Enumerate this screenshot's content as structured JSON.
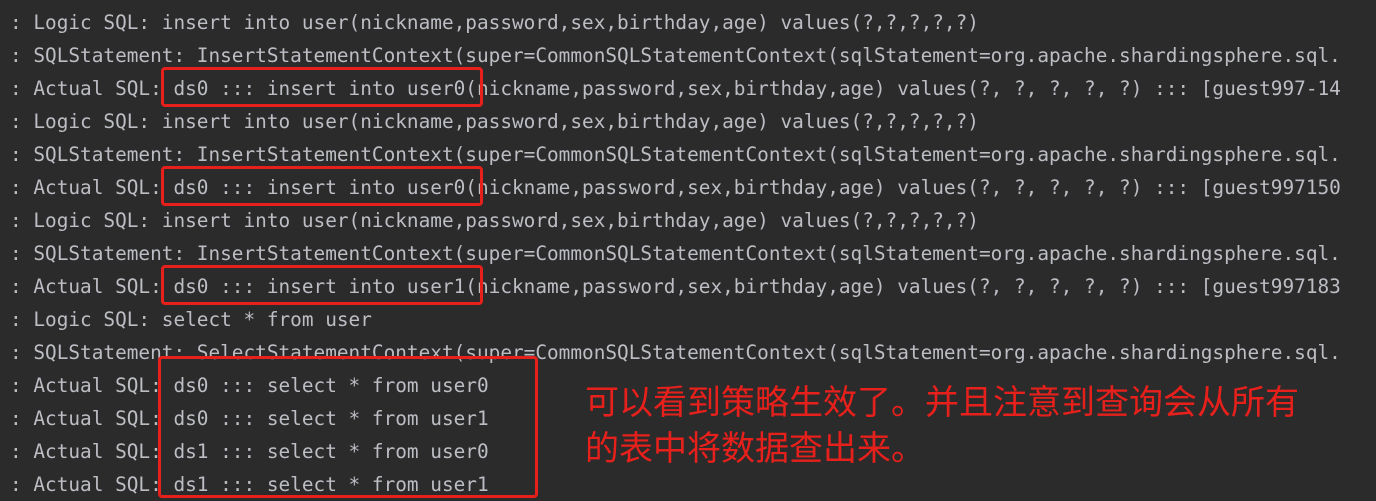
{
  "console": {
    "lines": [
      ": Logic SQL: insert into user(nickname,password,sex,birthday,age) values(?,?,?,?,?)",
      ": SQLStatement: InsertStatementContext(super=CommonSQLStatementContext(sqlStatement=org.apache.shardingsphere.sql.",
      ": Actual SQL: ds0 ::: insert into user0(nickname,password,sex,birthday,age) values(?, ?, ?, ?, ?) ::: [guest997-14",
      ": Logic SQL: insert into user(nickname,password,sex,birthday,age) values(?,?,?,?,?)",
      ": SQLStatement: InsertStatementContext(super=CommonSQLStatementContext(sqlStatement=org.apache.shardingsphere.sql.",
      ": Actual SQL: ds0 ::: insert into user0(nickname,password,sex,birthday,age) values(?, ?, ?, ?, ?) ::: [guest997150",
      ": Logic SQL: insert into user(nickname,password,sex,birthday,age) values(?,?,?,?,?)",
      ": SQLStatement: InsertStatementContext(super=CommonSQLStatementContext(sqlStatement=org.apache.shardingsphere.sql.",
      ": Actual SQL: ds0 ::: insert into user1(nickname,password,sex,birthday,age) values(?, ?, ?, ?, ?) ::: [guest997183",
      ": Logic SQL: select * from user",
      ": SQLStatement: SelectStatementContext(super=CommonSQLStatementContext(sqlStatement=org.apache.shardingsphere.sql.",
      ": Actual SQL: ds0 ::: select * from user0",
      ": Actual SQL: ds0 ::: select * from user1",
      ": Actual SQL: ds1 ::: select * from user0",
      ": Actual SQL: ds1 ::: select * from user1"
    ]
  },
  "annotation": {
    "line1": "可以看到策略生效了。并且注意到查询会从所有",
    "line2": "的表中将数据查出来。"
  },
  "colors": {
    "background": "#2b2b2b",
    "text": "#bcbec4",
    "highlight": "#e8201c"
  }
}
